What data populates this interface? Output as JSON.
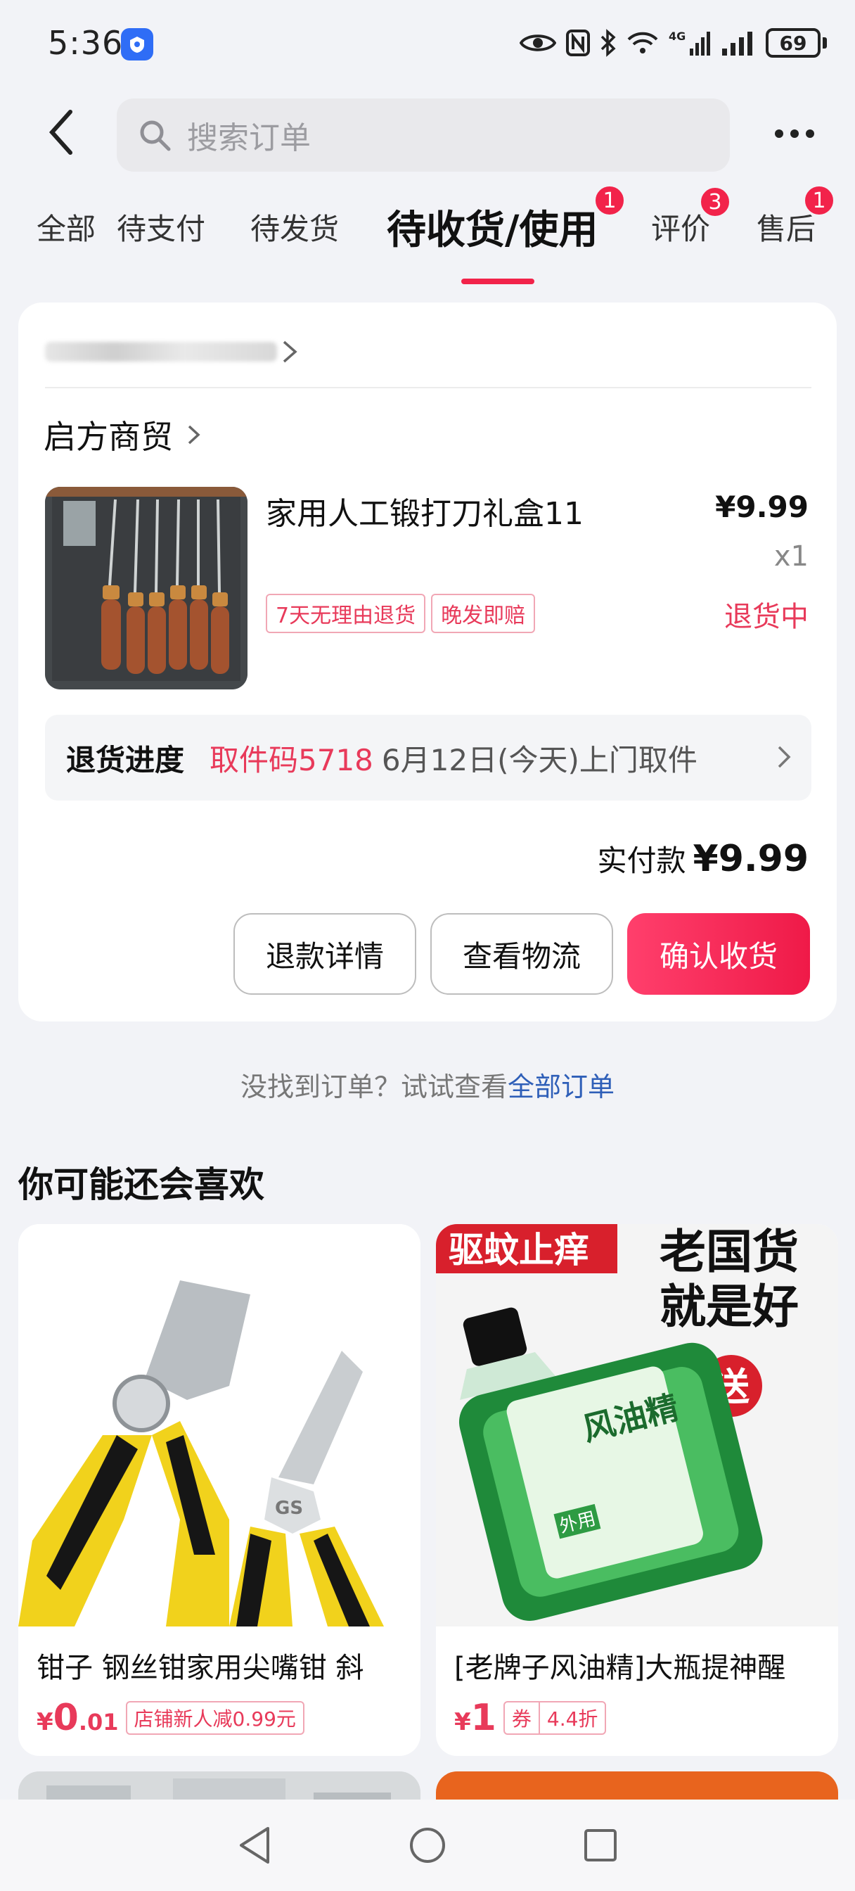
{
  "status_bar": {
    "time": "5:36",
    "network": "4G",
    "battery": "69"
  },
  "header": {
    "search_placeholder": "搜索订单"
  },
  "tabs": [
    {
      "label": "全部"
    },
    {
      "label": "待支付"
    },
    {
      "label": "待发货"
    },
    {
      "label": "待收货/使用",
      "badge": "1"
    },
    {
      "label": "评价",
      "badge": "3"
    },
    {
      "label": "售后",
      "badge": "1"
    }
  ],
  "order": {
    "shop_name": "启方商贸",
    "product_title": "家用人工锻打刀礼盒11",
    "price": "¥9.99",
    "quantity": "x1",
    "status": "退货中",
    "tags": [
      "7天无理由退货",
      "晚发即赔"
    ],
    "return_progress": {
      "label": "退货进度",
      "code": "取件码5718",
      "desc": "6月12日(今天)上门取件"
    },
    "paid_label": "实付款",
    "paid_value": "¥9.99",
    "buttons": {
      "refund_details": "退款详情",
      "view_logistics": "查看物流",
      "confirm_receipt": "确认收货"
    }
  },
  "not_found": {
    "text": "没找到订单？试试查看",
    "link": "全部订单"
  },
  "recommend": {
    "title": "你可能还会喜欢",
    "items": [
      {
        "name": "钳子 钢丝钳家用尖嘴钳 斜",
        "price_symbol": "¥",
        "price_int": "0",
        "price_dec": ".01",
        "tag": "店铺新人减0.99元"
      },
      {
        "name": "[老牌子风油精]大瓶提神醒",
        "price_symbol": "¥",
        "price_int": "1",
        "price_dec": "",
        "coupon_label": "券",
        "coupon_value": "4.4折",
        "image_text": {
          "banner": "驱蚊止痒",
          "slogan_1": "老国货",
          "slogan_2": "就是好",
          "gift": "送",
          "bottle_label": "风油精",
          "use": "外用"
        }
      }
    ]
  },
  "colors": {
    "accent": "#f2234a",
    "status_red": "#e83a5a",
    "link_blue": "#2f5fb8",
    "background": "#f2f3f7"
  }
}
